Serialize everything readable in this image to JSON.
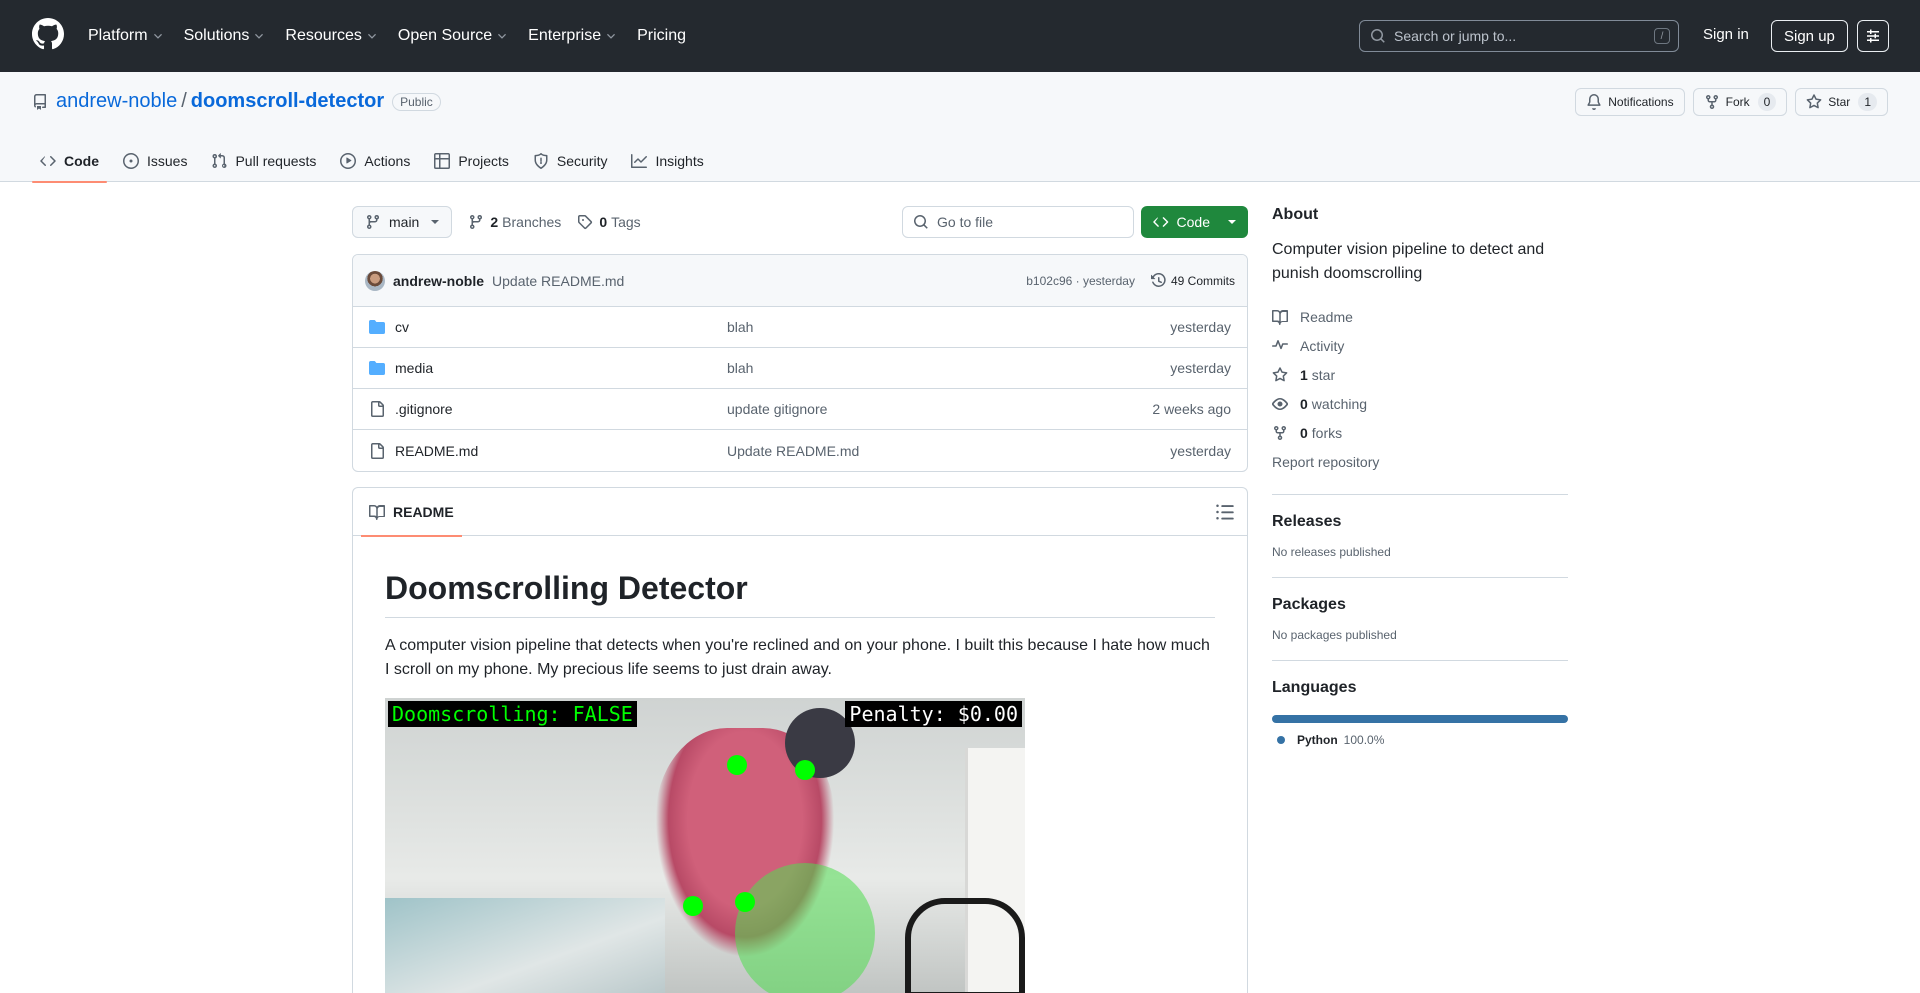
{
  "header": {
    "nav": [
      "Platform",
      "Solutions",
      "Resources",
      "Open Source",
      "Enterprise",
      "Pricing"
    ],
    "search_placeholder": "Search or jump to...",
    "search_kbd": "/",
    "signin": "Sign in",
    "signup": "Sign up"
  },
  "repo": {
    "owner": "andrew-noble",
    "separator": "/",
    "name": "doomscroll-detector",
    "visibility": "Public",
    "actions": {
      "notifications": "Notifications",
      "fork": "Fork",
      "fork_count": "0",
      "star": "Star",
      "star_count": "1"
    },
    "tabs": [
      "Code",
      "Issues",
      "Pull requests",
      "Actions",
      "Projects",
      "Security",
      "Insights"
    ]
  },
  "toolbar": {
    "branch": "main",
    "branches_count": "2",
    "branches_label": "Branches",
    "tags_count": "0",
    "tags_label": "Tags",
    "goto_placeholder": "Go to file",
    "code_label": "Code"
  },
  "commit": {
    "author": "andrew-noble",
    "message": "Update README.md",
    "hash_time": "b102c96 · yesterday",
    "commits": "49 Commits"
  },
  "files": [
    {
      "name": "cv",
      "type": "folder",
      "message": "blah",
      "date": "yesterday"
    },
    {
      "name": "media",
      "type": "folder",
      "message": "blah",
      "date": "yesterday"
    },
    {
      "name": ".gitignore",
      "type": "file",
      "message": "update gitignore",
      "date": "2 weeks ago"
    },
    {
      "name": "README.md",
      "type": "file",
      "message": "Update README.md",
      "date": "yesterday"
    }
  ],
  "readme": {
    "tab": "README",
    "title": "Doomscrolling Detector",
    "paragraph": "A computer vision pipeline that detects when you're reclined and on your phone. I built this because I hate how much I scroll on my phone. My precious life seems to just drain away.",
    "demo_label_left": "Doomscrolling: FALSE",
    "demo_label_right": "Penalty: $0.00"
  },
  "sidebar": {
    "about_title": "About",
    "description": "Computer vision pipeline to detect and punish doomscrolling",
    "links": {
      "readme": "Readme",
      "activity": "Activity",
      "stars_count": "1",
      "stars_label": "star",
      "watching_count": "0",
      "watching_label": "watching",
      "forks_count": "0",
      "forks_label": "forks",
      "report": "Report repository"
    },
    "releases_title": "Releases",
    "releases_text": "No releases published",
    "packages_title": "Packages",
    "packages_text": "No packages published",
    "languages_title": "Languages",
    "languages": [
      {
        "name": "Python",
        "percent": "100.0%",
        "color": "#3572a5"
      }
    ]
  },
  "colors": {
    "header_bg": "#24292f",
    "accent_link": "#0969da",
    "code_button": "#1f883d",
    "tab_underline": "#fd8c73",
    "folder_icon": "#54aeff"
  }
}
